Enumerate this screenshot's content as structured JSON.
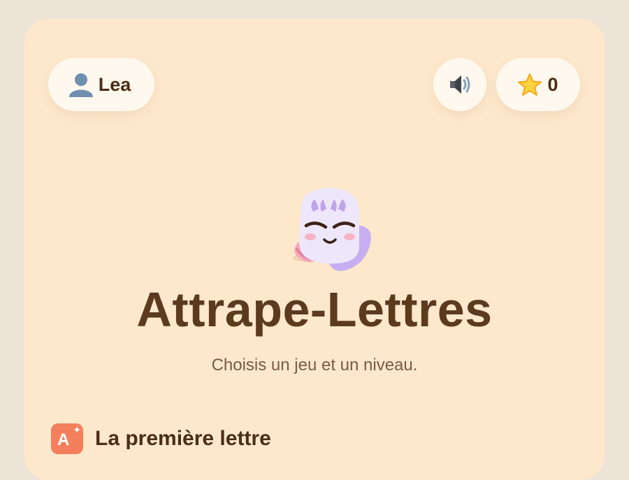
{
  "header": {
    "player_name": "Lea",
    "user_icon": "user-silhouette-icon",
    "sound_icon": "speaker-icon",
    "star_icon": "star-icon",
    "stars": "0"
  },
  "hero": {
    "mascot": "sleeping-ghost-mascot",
    "title": "Attrape-Lettres",
    "subtitle": "Choisis un jeu et un niveau."
  },
  "sections": [
    {
      "icon": "letter-a-sparkle-icon",
      "icon_letter": "A",
      "title": "La première lettre"
    }
  ],
  "colors": {
    "page_bg": "#ede4d8",
    "card_bg": "#fde8cc",
    "pill_bg": "#fff8ee",
    "title": "#5b3a1e",
    "accent": "#f47f5c",
    "mascot": "#c9b8f2"
  }
}
